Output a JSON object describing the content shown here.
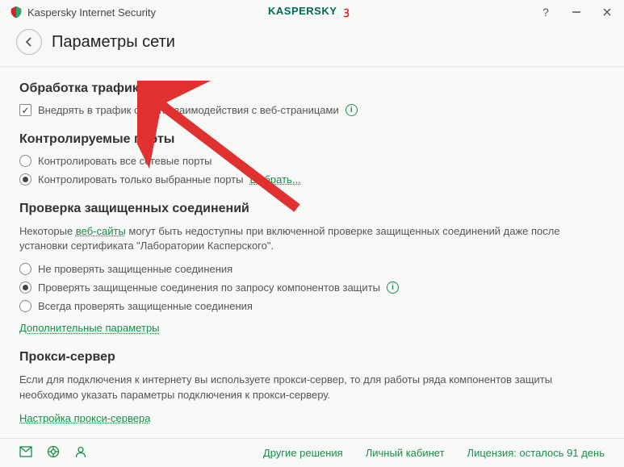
{
  "app": {
    "title": "Kaspersky Internet Security",
    "brand": "KASPERSKY"
  },
  "header": {
    "pageTitle": "Параметры сети"
  },
  "sections": {
    "traffic": {
      "title": "Обработка трафика",
      "injectScript": "Внедрять в трафик скрипт взаимодействия с веб-страницами"
    },
    "ports": {
      "title": "Контролируемые порты",
      "allPorts": "Контролировать все сетевые порты",
      "selectedPorts": "Контролировать только выбранные порты",
      "selectLink": "Выбрать..."
    },
    "secure": {
      "title": "Проверка защищенных соединений",
      "descPrefix": "Некоторые ",
      "webSitesLink": "веб-сайты",
      "descSuffix": " могут быть недоступны при включенной проверке защищенных соединений даже после установки сертификата \"Лаборатории Касперского\".",
      "optNoCheck": "Не проверять защищенные соединения",
      "optCheckOnRequest": "Проверять защищенные соединения по запросу компонентов защиты",
      "optAlwaysCheck": "Всегда проверять защищенные соединения",
      "additionalLink": "Дополнительные параметры"
    },
    "proxy": {
      "title": "Прокси-сервер",
      "desc": "Если для подключения к интернету вы используете прокси-сервер, то для работы ряда компонентов защиты необходимо указать параметры подключения к прокси-серверу.",
      "configLink": "Настройка прокси-сервера"
    }
  },
  "statusbar": {
    "otherSolutions": "Другие решения",
    "account": "Личный кабинет",
    "license": "Лицензия: осталось 91 день"
  }
}
